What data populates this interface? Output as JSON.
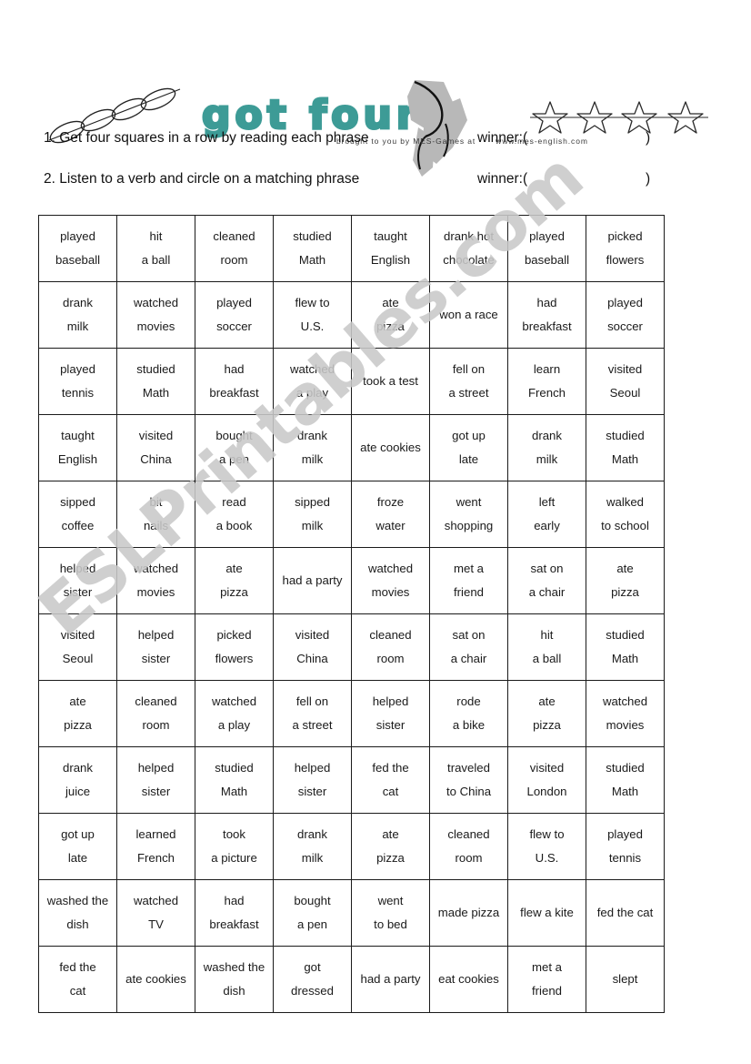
{
  "header": {
    "title": "got four",
    "credit_text": "brought  to you  by  MES-Games  at",
    "credit_url": "www.mes-english.com",
    "decorations": {
      "chain_icon": "four-in-a-row-ellipses-icon",
      "stars_icon": "four-stars-icon",
      "hand_icon": "hand-holding-disc-icon"
    },
    "accent_color": "#3d9b96"
  },
  "watermark": {
    "text": "ESLPrintables.com",
    "color": "#c9c9c9"
  },
  "instructions": [
    {
      "text": "1. Get four squares in a row by reading each phrase",
      "winner_label": "winner:(",
      "winner_close": ")"
    },
    {
      "text": "2. Listen to a verb and circle on a matching phrase",
      "winner_label": "winner:(",
      "winner_close": ")"
    }
  ],
  "grid": {
    "columns": 8,
    "rows": 12,
    "cells": [
      [
        [
          "played",
          "baseball"
        ],
        [
          "hit",
          "a ball"
        ],
        [
          "cleaned",
          "room"
        ],
        [
          "studied",
          "Math"
        ],
        [
          "taught",
          "English"
        ],
        [
          "drank hot",
          "chocolate"
        ],
        [
          "played",
          "baseball"
        ],
        [
          "picked",
          "flowers"
        ]
      ],
      [
        [
          "drank",
          "milk"
        ],
        [
          "watched",
          "movies"
        ],
        [
          "played",
          "soccer"
        ],
        [
          "flew to",
          "U.S."
        ],
        [
          "ate",
          "pizza"
        ],
        [
          "won a race"
        ],
        [
          "had",
          "breakfast"
        ],
        [
          "played",
          "soccer"
        ]
      ],
      [
        [
          "played",
          "tennis"
        ],
        [
          "studied",
          "Math"
        ],
        [
          "had",
          "breakfast"
        ],
        [
          "watched",
          "a play"
        ],
        [
          "took a test"
        ],
        [
          "fell on",
          "a street"
        ],
        [
          "learn",
          "French"
        ],
        [
          "visited",
          "Seoul"
        ]
      ],
      [
        [
          "taught",
          "English"
        ],
        [
          "visited",
          "China"
        ],
        [
          "bought",
          "a pen"
        ],
        [
          "drank",
          "milk"
        ],
        [
          "ate cookies"
        ],
        [
          "got up",
          "late"
        ],
        [
          "drank",
          "milk"
        ],
        [
          "studied",
          "Math"
        ]
      ],
      [
        [
          "sipped",
          "coffee"
        ],
        [
          "bit",
          "nails"
        ],
        [
          "read",
          "a book"
        ],
        [
          "sipped",
          "milk"
        ],
        [
          "froze",
          "water"
        ],
        [
          "went",
          "shopping"
        ],
        [
          "left",
          "early"
        ],
        [
          "walked",
          "to school"
        ]
      ],
      [
        [
          "helped",
          "sister"
        ],
        [
          "watched",
          "movies"
        ],
        [
          "ate",
          "pizza"
        ],
        [
          "had a party"
        ],
        [
          "watched",
          "movies"
        ],
        [
          "met a",
          "friend"
        ],
        [
          "sat on",
          "a chair"
        ],
        [
          "ate",
          "pizza"
        ]
      ],
      [
        [
          "visited",
          "Seoul"
        ],
        [
          "helped",
          "sister"
        ],
        [
          "picked",
          "flowers"
        ],
        [
          "visited",
          "China"
        ],
        [
          "cleaned",
          "room"
        ],
        [
          "sat on",
          "a chair"
        ],
        [
          "hit",
          "a ball"
        ],
        [
          "studied",
          "Math"
        ]
      ],
      [
        [
          "ate",
          "pizza"
        ],
        [
          "cleaned",
          "room"
        ],
        [
          "watched",
          "a play"
        ],
        [
          "fell on",
          "a street"
        ],
        [
          "helped",
          "sister"
        ],
        [
          "rode",
          "a bike"
        ],
        [
          "ate",
          "pizza"
        ],
        [
          "watched",
          "movies"
        ]
      ],
      [
        [
          "drank",
          "juice"
        ],
        [
          "helped",
          "sister"
        ],
        [
          "studied",
          "Math"
        ],
        [
          "helped",
          "sister"
        ],
        [
          "fed the",
          "cat"
        ],
        [
          "traveled",
          "to China"
        ],
        [
          "visited",
          "London"
        ],
        [
          "studied",
          "Math"
        ]
      ],
      [
        [
          "got up",
          "late"
        ],
        [
          "learned",
          "French"
        ],
        [
          "took",
          "a picture"
        ],
        [
          "drank",
          "milk"
        ],
        [
          "ate",
          "pizza"
        ],
        [
          "cleaned",
          "room"
        ],
        [
          "flew to",
          "U.S."
        ],
        [
          "played",
          "tennis"
        ]
      ],
      [
        [
          "washed the",
          "dish"
        ],
        [
          "watched",
          "TV"
        ],
        [
          "had",
          "breakfast"
        ],
        [
          "bought",
          "a pen"
        ],
        [
          "went",
          "to bed"
        ],
        [
          "made pizza"
        ],
        [
          "flew a kite"
        ],
        [
          "fed the cat"
        ]
      ],
      [
        [
          "fed the",
          "cat"
        ],
        [
          "ate cookies"
        ],
        [
          "washed the",
          "dish"
        ],
        [
          "got",
          "dressed"
        ],
        [
          "had a party"
        ],
        [
          "eat cookies"
        ],
        [
          "met a",
          "friend"
        ],
        [
          "slept"
        ]
      ]
    ]
  }
}
